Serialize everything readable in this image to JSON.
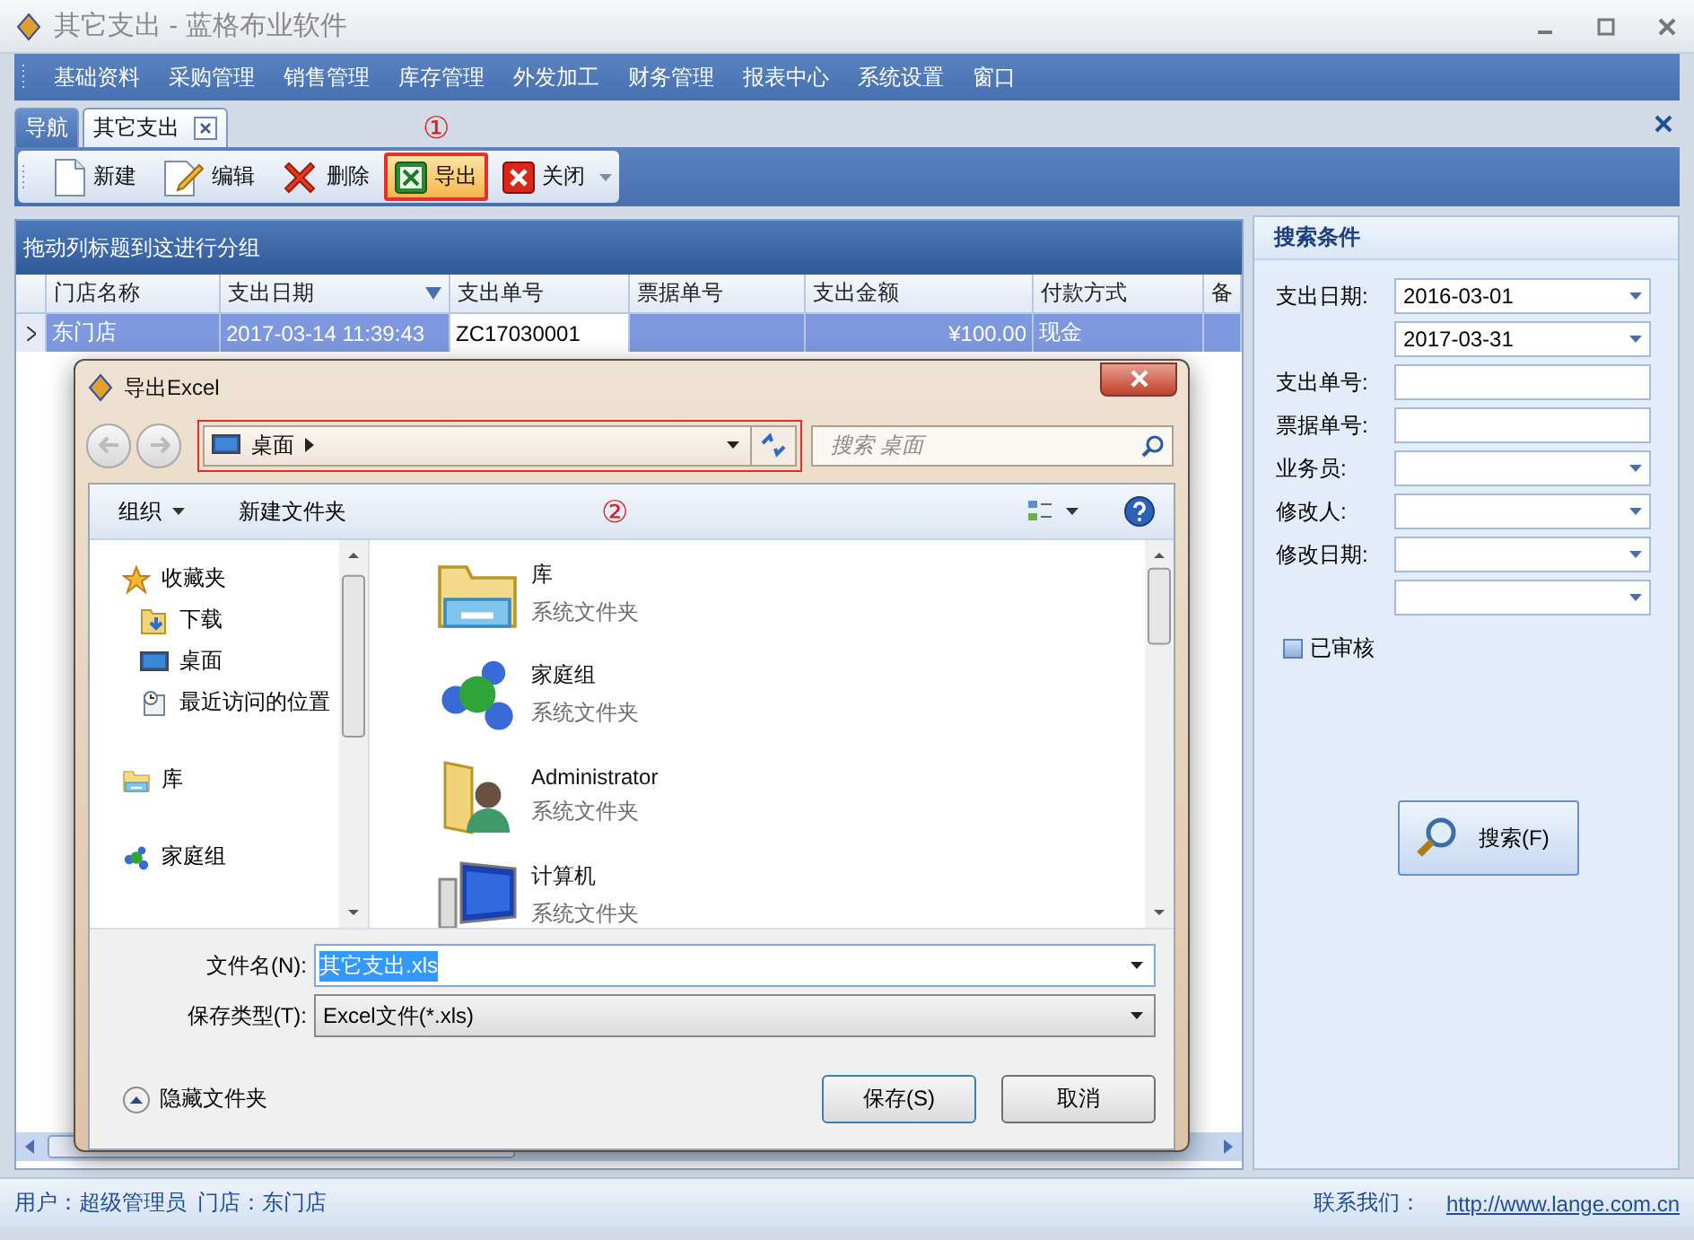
{
  "window": {
    "title": "其它支出 - 蓝格布业软件"
  },
  "menu": [
    "基础资料",
    "采购管理",
    "销售管理",
    "库存管理",
    "外发加工",
    "财务管理",
    "报表中心",
    "系统设置",
    "窗口"
  ],
  "tabs": [
    {
      "label": "导航",
      "selected": false,
      "closable": false
    },
    {
      "label": "其它支出",
      "selected": true,
      "closable": true
    }
  ],
  "toolbar": {
    "annotation": "①",
    "buttons": [
      {
        "label": "新建",
        "kind": "new",
        "highlighted": false
      },
      {
        "label": "编辑",
        "kind": "edit",
        "highlighted": false
      },
      {
        "label": "删除",
        "kind": "delete",
        "highlighted": false
      },
      {
        "label": "导出",
        "kind": "export",
        "highlighted": true
      },
      {
        "label": "关闭",
        "kind": "close",
        "highlighted": false
      }
    ]
  },
  "grid": {
    "group_hint": "拖动列标题到这进行分组",
    "columns": [
      {
        "label": "门店名称",
        "sorted": false
      },
      {
        "label": "支出日期",
        "sorted": true
      },
      {
        "label": "支出单号",
        "sorted": false
      },
      {
        "label": "票据单号",
        "sorted": false
      },
      {
        "label": "支出金额",
        "sorted": false
      },
      {
        "label": "付款方式",
        "sorted": false
      },
      {
        "label": "备",
        "sorted": false
      }
    ],
    "rows": [
      {
        "selected": true,
        "cells": [
          {
            "text": "东门店",
            "kind": "text",
            "focused": false
          },
          {
            "text": "2017-03-14 11:39:43",
            "kind": "text",
            "focused": false
          },
          {
            "text": "ZC17030001",
            "kind": "text",
            "focused": true
          },
          {
            "focused": false
          },
          {
            "text": "¥100.00",
            "kind": "amount",
            "focused": false
          },
          {
            "text": "现金",
            "kind": "text",
            "focused": false
          },
          {
            "focused": false
          }
        ]
      }
    ]
  },
  "search_panel": {
    "title": "搜索条件",
    "fields": [
      {
        "label": "支出日期:",
        "kind": "select",
        "value": "2016-03-01"
      },
      {
        "kind": "select",
        "value": "2017-03-31"
      },
      {
        "label": "支出单号:",
        "kind": "text"
      },
      {
        "label": "票据单号:",
        "kind": "text"
      },
      {
        "label": "业务员:",
        "kind": "select"
      },
      {
        "label": "修改人:",
        "kind": "select"
      },
      {
        "label": "修改日期:",
        "kind": "select"
      },
      {
        "kind": "select"
      }
    ],
    "checkbox": {
      "label": "已审核",
      "checked": false
    },
    "button": "搜索(F)"
  },
  "status_bar": {
    "user": "用户：超级管理员",
    "store": "门店：东门店",
    "contact": "联系我们：",
    "link": "http://www.lange.com.cn"
  },
  "dialog": {
    "title": "导出Excel",
    "address": "桌面",
    "search_placeholder": "搜索 桌面",
    "commands": [
      "组织",
      "新建文件夹"
    ],
    "annotation": "②",
    "nav": [
      {
        "label": "收藏夹",
        "kind": "star",
        "children": [
          {
            "label": "下载",
            "kind": "download"
          },
          {
            "label": "桌面",
            "kind": "desktop"
          },
          {
            "label": "最近访问的位置",
            "kind": "recent"
          }
        ]
      },
      {
        "label": "库",
        "kind": "library"
      },
      {
        "label": "家庭组",
        "kind": "homegroup"
      }
    ],
    "items": [
      {
        "name": "库",
        "type": "系统文件夹",
        "kind": "library"
      },
      {
        "name": "家庭组",
        "type": "系统文件夹",
        "kind": "homegroup"
      },
      {
        "name": "Administrator",
        "type": "系统文件夹",
        "kind": "user"
      },
      {
        "name": "计算机",
        "type": "系统文件夹",
        "kind": "computer"
      }
    ],
    "file_name_label": "文件名(N):",
    "file_name": "其它支出.xls",
    "file_type_label": "保存类型(T):",
    "file_type": "Excel文件(*.xls)",
    "hide_folders": "隐藏文件夹",
    "save": "保存(S)",
    "cancel": "取消"
  }
}
